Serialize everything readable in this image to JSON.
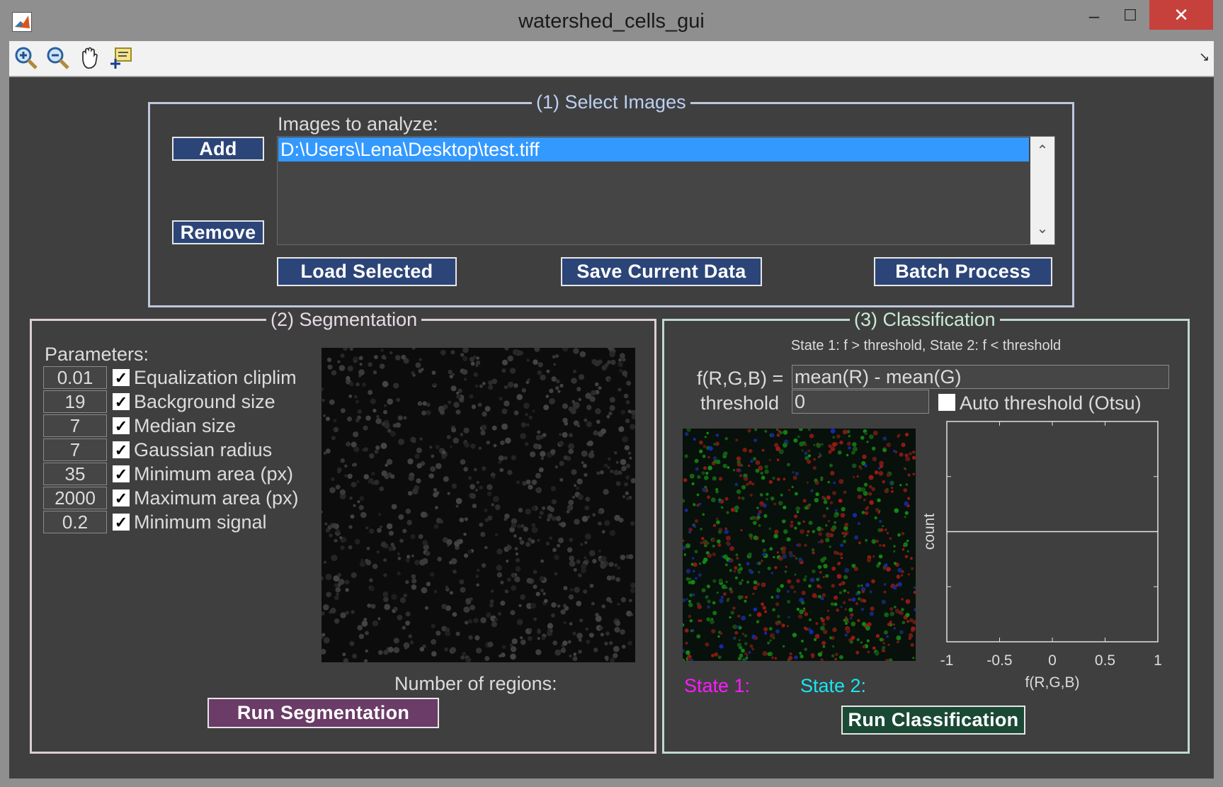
{
  "window": {
    "title": "watershed_cells_gui",
    "minimize": "–",
    "maximize": "☐",
    "close": "✕"
  },
  "toolbar": {
    "tools": [
      "zoom-in-icon",
      "zoom-out-icon",
      "pan-hand-icon",
      "data-cursor-icon"
    ],
    "overflow": "↘"
  },
  "select_images": {
    "title": "(1) Select Images",
    "add_label": "Add",
    "remove_label": "Remove",
    "list_label": "Images to analyze:",
    "files": [
      "D:\\Users\\Lena\\Desktop\\test.tiff"
    ],
    "load_label": "Load Selected",
    "save_label": "Save Current Data",
    "batch_label": "Batch Process",
    "scroll_up": "⌃",
    "scroll_down": "⌄"
  },
  "segmentation": {
    "title": "(2) Segmentation",
    "params_label": "Parameters:",
    "params": [
      {
        "value": "0.01",
        "checked": true,
        "label": "Equalization cliplim"
      },
      {
        "value": "19",
        "checked": true,
        "label": "Background size"
      },
      {
        "value": "7",
        "checked": true,
        "label": "Median size"
      },
      {
        "value": "7",
        "checked": true,
        "label": "Gaussian radius"
      },
      {
        "value": "35",
        "checked": true,
        "label": "Minimum area (px)"
      },
      {
        "value": "2000",
        "checked": true,
        "label": "Maximum area (px)"
      },
      {
        "value": "0.2",
        "checked": true,
        "label": "Minimum signal"
      }
    ],
    "regions_label": "Number of regions:",
    "run_label": "Run Segmentation"
  },
  "classification": {
    "title": "(3) Classification",
    "rule": "State 1: f > threshold, State 2: f < threshold",
    "f_label": "f(R,G,B) =",
    "f_value": "mean(R) - mean(G)",
    "threshold_label": "threshold",
    "threshold_value": "0",
    "auto_threshold_label": "Auto threshold (Otsu)",
    "auto_threshold_checked": false,
    "state1_label": "State 1:",
    "state2_label": "State 2:",
    "run_label": "Run Classification"
  },
  "chart_data": {
    "type": "bar",
    "title": "",
    "xlabel": "f(R,G,B)",
    "ylabel": "count",
    "xlim": [
      -1,
      1
    ],
    "xticks": [
      "-1",
      "-0.5",
      "0",
      "0.5",
      "1"
    ],
    "series": [],
    "threshold_line": 0
  },
  "colors": {
    "background": "#3f3f3f",
    "blue_button": "#2c4578",
    "segmentation_button": "#6a3c67",
    "classification_button": "#1b4a34",
    "selection": "#3399ff",
    "state1": "#ff19ff",
    "state2": "#19e6f0",
    "close_button": "#c7413c"
  }
}
